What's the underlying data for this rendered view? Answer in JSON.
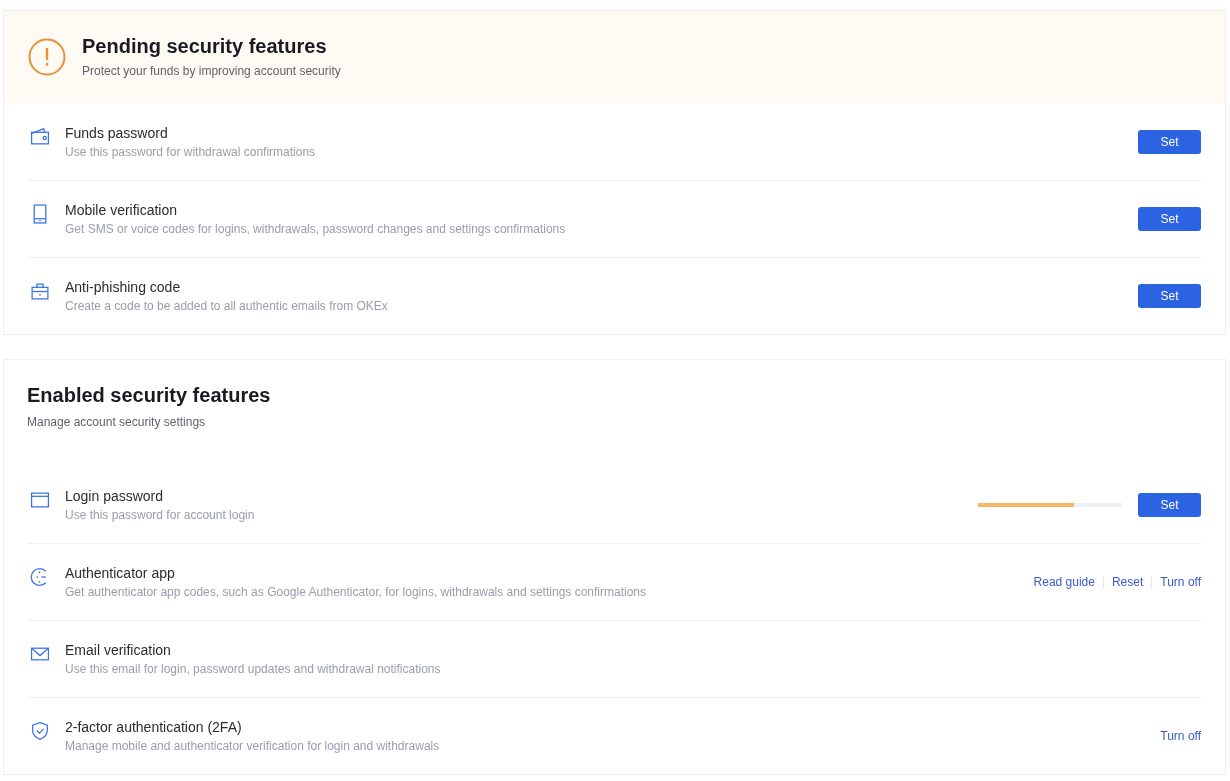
{
  "pending": {
    "title": "Pending security features",
    "subtitle": "Protect your funds by improving account security",
    "items": [
      {
        "title": "Funds password",
        "description": "Use this password for withdrawal confirmations",
        "actions": [
          {
            "kind": "button",
            "label": "Set"
          }
        ]
      },
      {
        "title": "Mobile verification",
        "description": "Get SMS or voice codes for logins, withdrawals, password changes and settings confirmations",
        "actions": [
          {
            "kind": "button",
            "label": "Set"
          }
        ]
      },
      {
        "title": "Anti-phishing code",
        "description": "Create a code to be added to all authentic emails from OKEx",
        "actions": [
          {
            "kind": "button",
            "label": "Set"
          }
        ]
      }
    ]
  },
  "enabled": {
    "title": "Enabled security features",
    "subtitle": "Manage account security settings",
    "items": [
      {
        "title": "Login password",
        "description": "Use this password for account login",
        "strength": {
          "level": 0.67
        },
        "actions": [
          {
            "kind": "button",
            "label": "Set"
          }
        ]
      },
      {
        "title": "Authenticator app",
        "description": "Get authenticator app codes, such as Google Authenticator, for logins, withdrawals and settings confirmations",
        "actions": [
          {
            "kind": "link",
            "label": "Read guide"
          },
          {
            "kind": "link",
            "label": "Reset"
          },
          {
            "kind": "link",
            "label": "Turn off"
          }
        ]
      },
      {
        "title": "Email verification",
        "description": "Use this email for login, password updates and withdrawal notifications"
      },
      {
        "title": "2-factor authentication (2FA)",
        "description": "Manage mobile and authenticator verification for login and withdrawals",
        "actions": [
          {
            "kind": "link",
            "label": "Turn off"
          }
        ]
      }
    ]
  }
}
